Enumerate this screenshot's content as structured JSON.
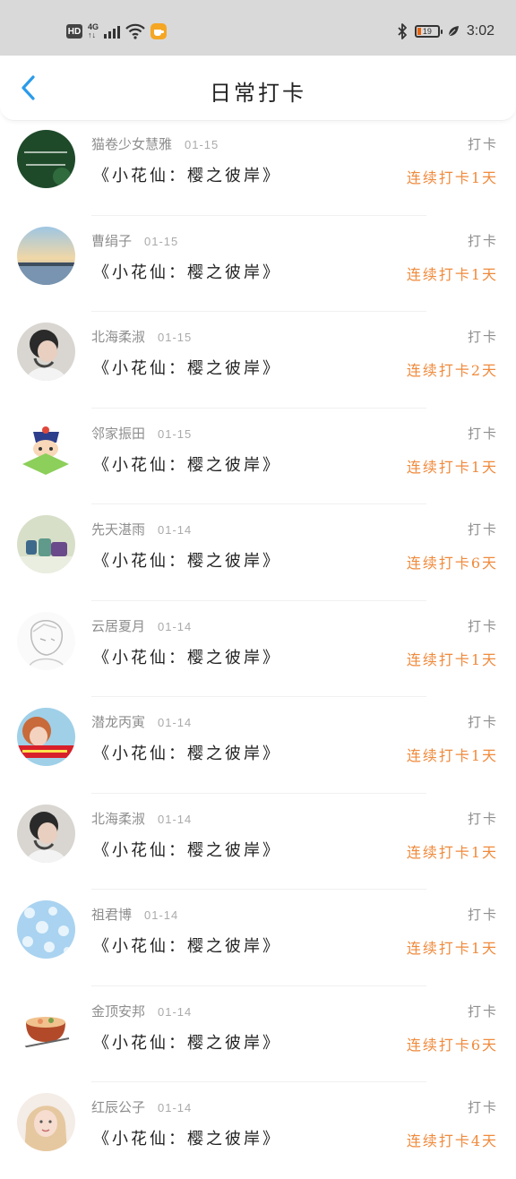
{
  "status_bar": {
    "hd": "HD",
    "net_gen_top": "4G",
    "net_gen_bottom": "↑↓",
    "battery_level": "19",
    "time": "3:02"
  },
  "header": {
    "title": "日常打卡",
    "back_icon": "chevron-left-icon"
  },
  "colors": {
    "accent_blue": "#2a9bea",
    "streak_orange": "#f08a3c",
    "status_bar_bg": "#d9d9d9"
  },
  "checkins": [
    {
      "name": "猫卷少女慧雅",
      "date": "01-15",
      "book": "《小花仙：樱之彼岸》",
      "action": "打卡",
      "streak": "连续打卡1天"
    },
    {
      "name": "曹绢子",
      "date": "01-15",
      "book": "《小花仙：樱之彼岸》",
      "action": "打卡",
      "streak": "连续打卡1天"
    },
    {
      "name": "北海柔淑",
      "date": "01-15",
      "book": "《小花仙：樱之彼岸》",
      "action": "打卡",
      "streak": "连续打卡2天"
    },
    {
      "name": "邻家振田",
      "date": "01-15",
      "book": "《小花仙：樱之彼岸》",
      "action": "打卡",
      "streak": "连续打卡1天"
    },
    {
      "name": "先天湛雨",
      "date": "01-14",
      "book": "《小花仙：樱之彼岸》",
      "action": "打卡",
      "streak": "连续打卡6天"
    },
    {
      "name": "云居夏月",
      "date": "01-14",
      "book": "《小花仙：樱之彼岸》",
      "action": "打卡",
      "streak": "连续打卡1天"
    },
    {
      "name": "潜龙丙寅",
      "date": "01-14",
      "book": "《小花仙：樱之彼岸》",
      "action": "打卡",
      "streak": "连续打卡1天"
    },
    {
      "name": "北海柔淑",
      "date": "01-14",
      "book": "《小花仙：樱之彼岸》",
      "action": "打卡",
      "streak": "连续打卡1天"
    },
    {
      "name": "祖君博",
      "date": "01-14",
      "book": "《小花仙：樱之彼岸》",
      "action": "打卡",
      "streak": "连续打卡1天"
    },
    {
      "name": "金顶安邦",
      "date": "01-14",
      "book": "《小花仙：樱之彼岸》",
      "action": "打卡",
      "streak": "连续打卡6天"
    },
    {
      "name": "红辰公子",
      "date": "01-14",
      "book": "《小花仙：樱之彼岸》",
      "action": "打卡",
      "streak": "连续打卡4天"
    }
  ]
}
